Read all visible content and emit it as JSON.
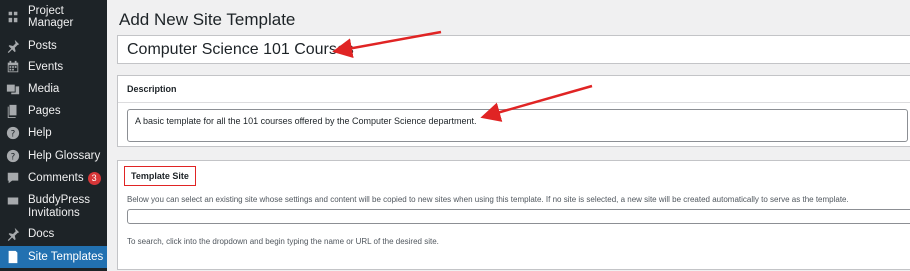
{
  "sidebar": {
    "items": [
      {
        "label": "Project Manager",
        "icon": "project-manager-icon"
      },
      {
        "label": "Posts",
        "icon": "pin-icon"
      },
      {
        "label": "Events",
        "icon": "calendar-icon"
      },
      {
        "label": "Media",
        "icon": "media-icon"
      },
      {
        "label": "Pages",
        "icon": "pages-icon"
      },
      {
        "label": "Help",
        "icon": "help-icon"
      },
      {
        "label": "Help Glossary",
        "icon": "help-glossary-icon"
      },
      {
        "label": "Comments",
        "icon": "comments-icon",
        "badge": "3"
      },
      {
        "label": "BuddyPress",
        "label2": "Invitations",
        "icon": "buddypress-icon"
      },
      {
        "label": "Docs",
        "icon": "pin-icon"
      },
      {
        "label": "Site Templates",
        "icon": "site-templates-icon",
        "active": true
      }
    ]
  },
  "main": {
    "page_title": "Add New Site Template",
    "title_value": "Computer Science 101 Courses",
    "description": {
      "heading": "Description",
      "value": "A basic template for all the 101 courses offered by the Computer Science department."
    },
    "template_site": {
      "heading": "Template Site",
      "help_text": "Below you can select an existing site whose settings and content will be copied to new sites when using this template.  If no site is selected, a new site will be created automatically to serve as the template.",
      "search_help": "To search, click into the dropdown and begin typing the name or URL of the desired site.",
      "selected_value": ""
    }
  },
  "colors": {
    "sidebar_bg": "#1d2327",
    "active_bg": "#2271b1",
    "badge": "#d63638",
    "annotation": "#e02424"
  }
}
